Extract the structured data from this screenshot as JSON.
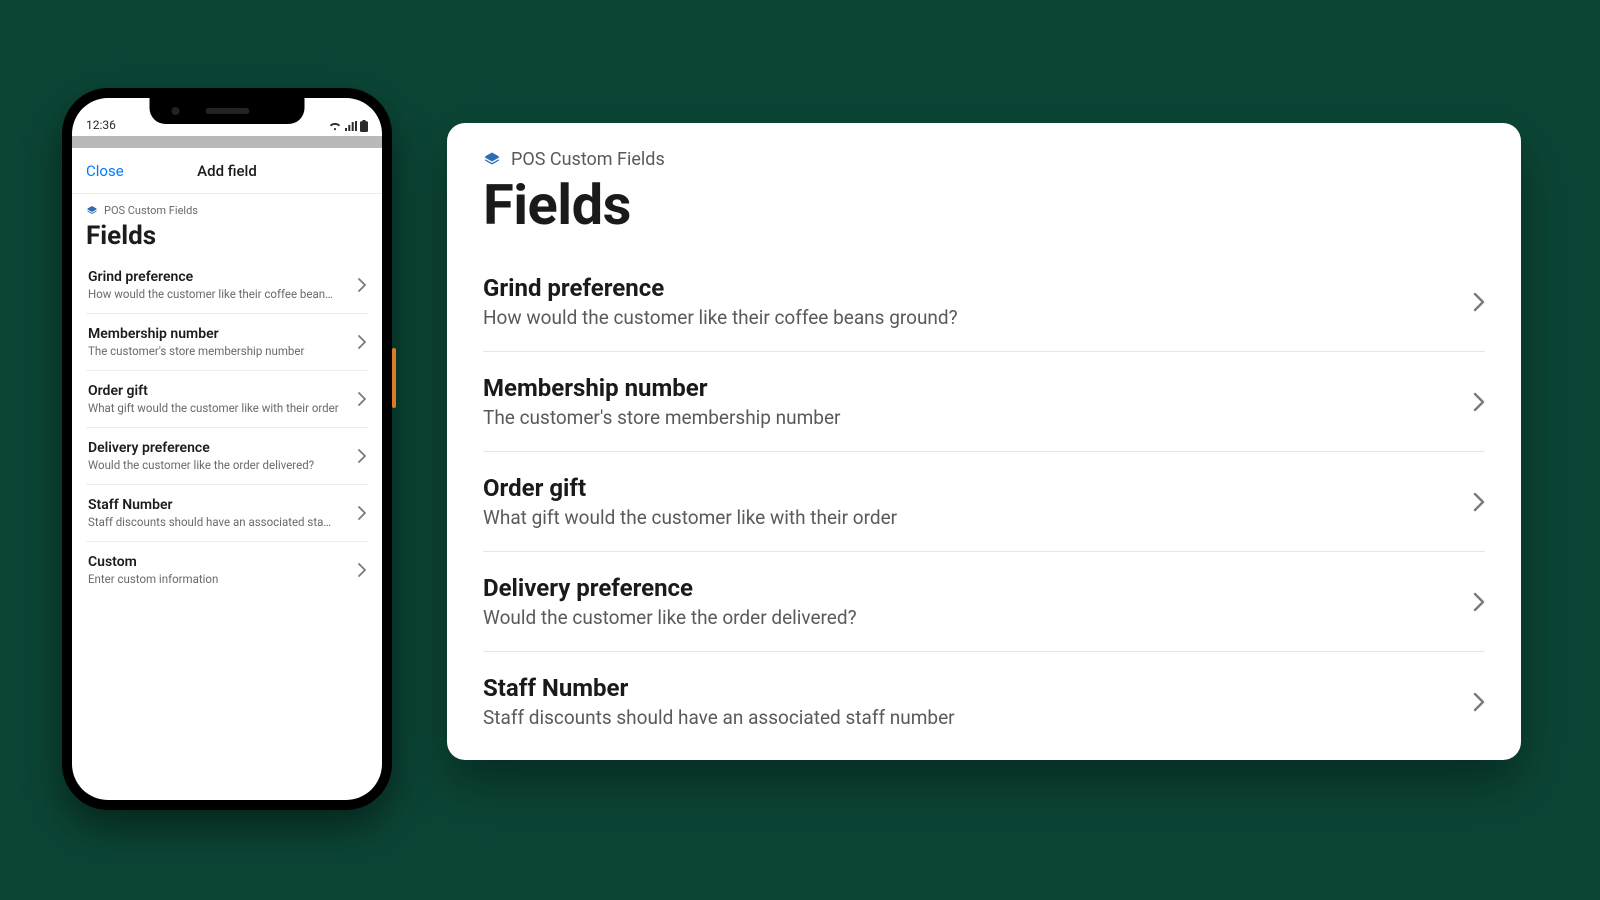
{
  "phone": {
    "status_time": "12:36",
    "close_label": "Close",
    "sheet_title": "Add field",
    "app_name": "POS Custom Fields",
    "heading": "Fields",
    "rows": [
      {
        "title": "Grind preference",
        "sub": "How would the customer like their coffee bean…"
      },
      {
        "title": "Membership number",
        "sub": "The customer's store membership number"
      },
      {
        "title": "Order gift",
        "sub": "What gift would the customer like with their order"
      },
      {
        "title": "Delivery preference",
        "sub": "Would the customer like the order delivered?"
      },
      {
        "title": "Staff Number",
        "sub": "Staff discounts should have an associated sta…"
      },
      {
        "title": "Custom",
        "sub": "Enter custom information"
      }
    ]
  },
  "panel": {
    "app_name": "POS Custom Fields",
    "heading": "Fields",
    "rows": [
      {
        "title": "Grind preference",
        "sub": "How would the customer like their coffee beans ground?"
      },
      {
        "title": "Membership number",
        "sub": "The customer's store membership number"
      },
      {
        "title": "Order gift",
        "sub": "What gift would the customer like with their order"
      },
      {
        "title": "Delivery preference",
        "sub": "Would the customer like the order delivered?"
      },
      {
        "title": "Staff Number",
        "sub": "Staff discounts should have an associated staff number"
      }
    ]
  }
}
